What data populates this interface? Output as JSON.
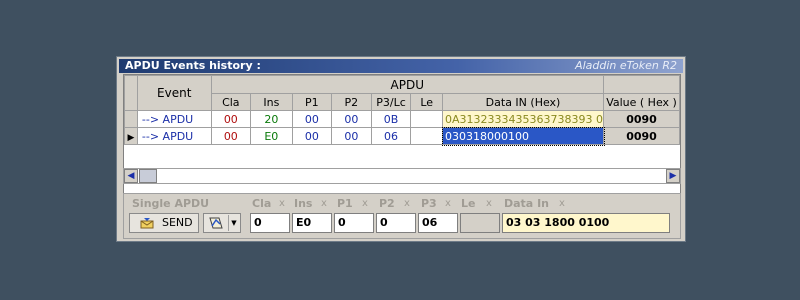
{
  "window": {
    "title": "APDU Events history :",
    "product": "Aladdin eToken R2"
  },
  "table": {
    "group_header": "APDU",
    "event_header": "Event",
    "columns": [
      "Cla",
      "Ins",
      "P1",
      "P2",
      "P3/Lc",
      "Le",
      "Data IN (Hex)",
      "Value ( Hex )"
    ],
    "rows": [
      {
        "event": "--> APDU",
        "cla": "00",
        "ins": "20",
        "p1": "00",
        "p2": "00",
        "p3": "0B",
        "le": "",
        "data": "0A3132333435363738393 0",
        "value": "0090",
        "selected": false
      },
      {
        "event": "--> APDU",
        "cla": "00",
        "ins": "E0",
        "p1": "00",
        "p2": "00",
        "p3": "06",
        "le": "",
        "data": "030318000100",
        "value": "0090",
        "selected": true
      }
    ]
  },
  "single_apdu": {
    "title": "Single APDU",
    "send_label": "SEND",
    "labels": {
      "cla": "Cla",
      "ins": "Ins",
      "p1": "P1",
      "p2": "P2",
      "p3": "P3",
      "le": "Le",
      "data": "Data In"
    },
    "x_mark": "x",
    "values": {
      "cla": "0",
      "ins": "E0",
      "p1": "0",
      "p2": "0",
      "p3": "06",
      "le": "",
      "data": "03 03 1800 0100"
    }
  },
  "icons": [
    "send-icon",
    "options-icon",
    "dropdown-arrow-icon",
    "scroll-left-icon",
    "scroll-right-icon",
    "row-indicator-icon"
  ],
  "colors": {
    "title_start": "#1f3b70",
    "title_end": "#8fa3cf",
    "selected_cell": "#2a57c6",
    "data_bg": "#fff7cc"
  }
}
